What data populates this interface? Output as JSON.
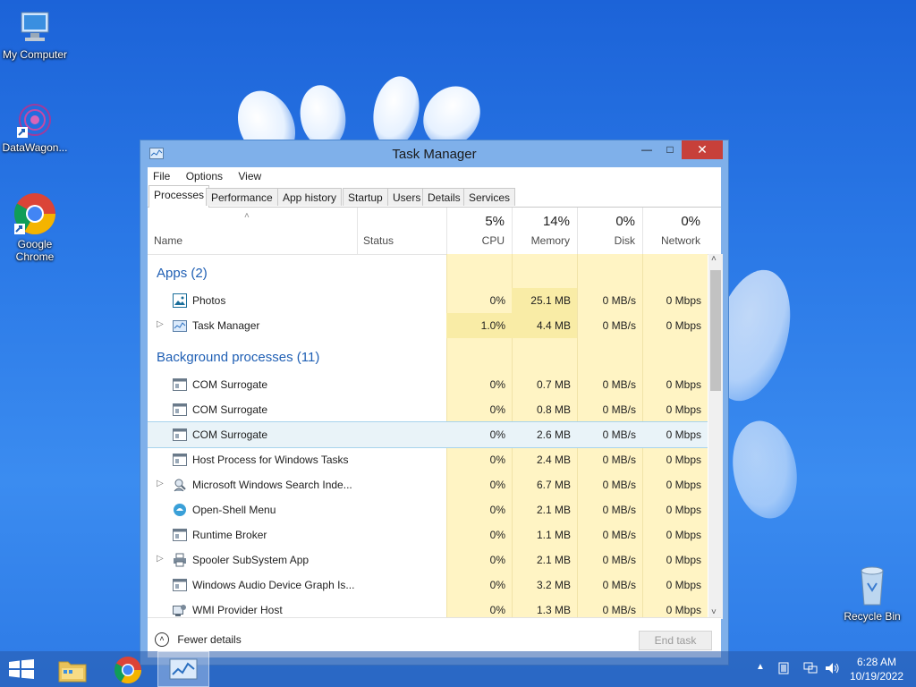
{
  "desktop": {
    "icons": [
      {
        "label": "My Computer"
      },
      {
        "label": "DataWagon..."
      },
      {
        "label": "Google Chrome"
      },
      {
        "label": "Recycle Bin"
      }
    ]
  },
  "window": {
    "title": "Task Manager",
    "menu": [
      "File",
      "Options",
      "View"
    ],
    "tabs": [
      "Processes",
      "Performance",
      "App history",
      "Startup",
      "Users",
      "Details",
      "Services"
    ],
    "active_tab": "Processes",
    "columns": {
      "name": "Name",
      "status": "Status",
      "cpu": {
        "pct": "5%",
        "label": "CPU"
      },
      "memory": {
        "pct": "14%",
        "label": "Memory"
      },
      "disk": {
        "pct": "0%",
        "label": "Disk"
      },
      "network": {
        "pct": "0%",
        "label": "Network"
      }
    },
    "groups": {
      "apps": "Apps (2)",
      "background": "Background processes (11)"
    },
    "apps": [
      {
        "name": "Photos",
        "cpu": "0%",
        "memory": "25.1 MB",
        "disk": "0 MB/s",
        "network": "0 Mbps",
        "icon": "photos-icon"
      },
      {
        "name": "Task Manager",
        "cpu": "1.0%",
        "memory": "4.4 MB",
        "disk": "0 MB/s",
        "network": "0 Mbps",
        "icon": "task-manager-icon"
      }
    ],
    "background": [
      {
        "name": "COM Surrogate",
        "cpu": "0%",
        "memory": "0.7 MB",
        "disk": "0 MB/s",
        "network": "0 Mbps"
      },
      {
        "name": "COM Surrogate",
        "cpu": "0%",
        "memory": "0.8 MB",
        "disk": "0 MB/s",
        "network": "0 Mbps"
      },
      {
        "name": "COM Surrogate",
        "cpu": "0%",
        "memory": "2.6 MB",
        "disk": "0 MB/s",
        "network": "0 Mbps"
      },
      {
        "name": "Host Process for Windows Tasks",
        "cpu": "0%",
        "memory": "2.4 MB",
        "disk": "0 MB/s",
        "network": "0 Mbps"
      },
      {
        "name": "Microsoft Windows Search Inde...",
        "cpu": "0%",
        "memory": "6.7 MB",
        "disk": "0 MB/s",
        "network": "0 Mbps"
      },
      {
        "name": "Open-Shell Menu",
        "cpu": "0%",
        "memory": "2.1 MB",
        "disk": "0 MB/s",
        "network": "0 Mbps"
      },
      {
        "name": "Runtime Broker",
        "cpu": "0%",
        "memory": "1.1 MB",
        "disk": "0 MB/s",
        "network": "0 Mbps"
      },
      {
        "name": "Spooler SubSystem App",
        "cpu": "0%",
        "memory": "2.1 MB",
        "disk": "0 MB/s",
        "network": "0 Mbps"
      },
      {
        "name": "Windows Audio Device Graph Is...",
        "cpu": "0%",
        "memory": "3.2 MB",
        "disk": "0 MB/s",
        "network": "0 Mbps"
      },
      {
        "name": "WMI Provider Host",
        "cpu": "0%",
        "memory": "1.3 MB",
        "disk": "0 MB/s",
        "network": "0 Mbps"
      }
    ],
    "footer": {
      "fewer_details": "Fewer details",
      "end_task": "End task"
    }
  },
  "taskbar": {
    "time": "6:28 AM",
    "date": "10/19/2022"
  },
  "colors": {
    "accent": "#1f5fb4",
    "heat": "#fff4c4",
    "close": "#c7403a"
  }
}
